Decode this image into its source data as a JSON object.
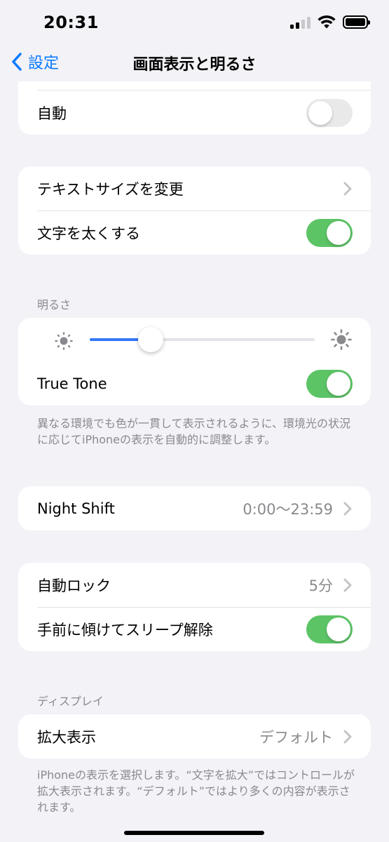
{
  "status": {
    "time": "20:31"
  },
  "nav": {
    "back_label": "設定",
    "title": "画面表示と明るさ"
  },
  "appearance": {
    "auto_label": "自動",
    "auto_on": false
  },
  "text": {
    "text_size_label": "テキストサイズを変更",
    "bold_text_label": "文字を太くする",
    "bold_text_on": true
  },
  "brightness": {
    "header": "明るさ",
    "level": 0.27,
    "true_tone_label": "True Tone",
    "true_tone_on": true,
    "footnote": "異なる環境でも色が一貫して表示されるように、環境光の状況に応じてiPhoneの表示を自動的に調整します。"
  },
  "night_shift": {
    "label": "Night Shift",
    "value": "0:00〜23:59"
  },
  "lock": {
    "auto_lock_label": "自動ロック",
    "auto_lock_value": "5分",
    "raise_to_wake_label": "手前に傾けてスリープ解除",
    "raise_to_wake_on": true
  },
  "display": {
    "header": "ディスプレイ",
    "zoom_label": "拡大表示",
    "zoom_value": "デフォルト",
    "footnote": "iPhoneの表示を選択します。“文字を拡大”ではコントロールが拡大表示されます。“デフォルト”ではより多くの内容が表示されます。"
  },
  "icons": {
    "back": "chevron-left-icon",
    "disclosure": "chevron-right-icon",
    "brightness_low": "sun-small-icon",
    "brightness_high": "sun-large-icon"
  },
  "colors": {
    "accent": "#0a7aff",
    "toggle_on": "#5dc466",
    "slider_fill": "#3478f6"
  }
}
